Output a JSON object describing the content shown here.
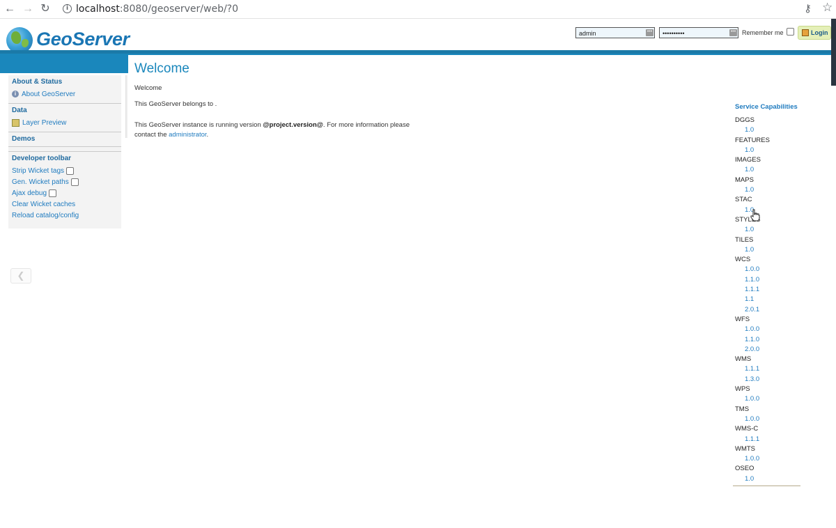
{
  "browser": {
    "url_host": "localhost",
    "url_path": ":8080/geoserver/web/?0",
    "back_icon": "back-arrow-icon",
    "forward_icon": "forward-arrow-icon",
    "reload_icon": "reload-icon"
  },
  "header": {
    "logo_text": "GeoServer",
    "username_value": "admin",
    "password_value": "••••••••••",
    "remember_label": "Remember me",
    "login_label": "Login"
  },
  "sidebar": {
    "sections": [
      {
        "title": "About & Status",
        "items": [
          {
            "label": "About GeoServer",
            "icon": "info-icon"
          }
        ]
      },
      {
        "title": "Data",
        "items": [
          {
            "label": "Layer Preview",
            "icon": "layer-preview-icon"
          }
        ]
      },
      {
        "title": "Demos",
        "items": []
      }
    ],
    "developer": {
      "title": "Developer toolbar",
      "strip_tags": "Strip Wicket tags",
      "gen_paths": "Gen. Wicket paths",
      "ajax_debug": "Ajax debug",
      "clear_caches": "Clear Wicket caches",
      "reload_catalog": "Reload catalog/config"
    }
  },
  "main": {
    "title": "Welcome",
    "welcome_message": "Welcome",
    "belongs_text": "This GeoServer belongs to .",
    "version_prefix": "This GeoServer instance is running version ",
    "version_value": "@project.version@",
    "version_suffix": ". For more information please contact the ",
    "admin_link": "administrator",
    "admin_suffix": "."
  },
  "capabilities": {
    "title": "Service Capabilities",
    "services": [
      {
        "name": "DGGS",
        "versions": [
          "1.0"
        ]
      },
      {
        "name": "FEATURES",
        "versions": [
          "1.0"
        ]
      },
      {
        "name": "IMAGES",
        "versions": [
          "1.0"
        ]
      },
      {
        "name": "MAPS",
        "versions": [
          "1.0"
        ]
      },
      {
        "name": "STAC",
        "versions": [
          "1.0"
        ]
      },
      {
        "name": "STYLES",
        "versions": [
          "1.0"
        ]
      },
      {
        "name": "TILES",
        "versions": [
          "1.0"
        ]
      },
      {
        "name": "WCS",
        "versions": [
          "1.0.0",
          "1.1.0",
          "1.1.1",
          "1.1",
          "2.0.1"
        ]
      },
      {
        "name": "WFS",
        "versions": [
          "1.0.0",
          "1.1.0",
          "2.0.0"
        ]
      },
      {
        "name": "WMS",
        "versions": [
          "1.1.1",
          "1.3.0"
        ]
      },
      {
        "name": "WPS",
        "versions": [
          "1.0.0"
        ]
      },
      {
        "name": "TMS",
        "versions": [
          "1.0.0"
        ]
      },
      {
        "name": "WMS-C",
        "versions": [
          "1.1.1"
        ]
      },
      {
        "name": "WMTS",
        "versions": [
          "1.0.0"
        ]
      },
      {
        "name": "OSEO",
        "versions": [
          "1.0"
        ]
      }
    ]
  }
}
